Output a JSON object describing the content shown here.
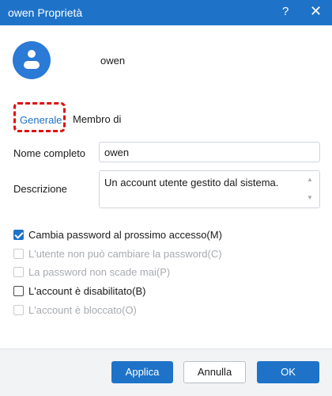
{
  "window": {
    "title": "owen Proprietà",
    "help_glyph": "?",
    "close_glyph": "✕",
    "accent_color": "#1e73c8"
  },
  "user": {
    "name": "owen"
  },
  "tabs": [
    {
      "label": "Generale",
      "active": true
    },
    {
      "label": "Membro di",
      "active": false
    }
  ],
  "form": {
    "full_name_label": "Nome completo",
    "full_name_value": "owen",
    "description_label": "Descrizione",
    "description_value": "Un account utente gestito dal sistema."
  },
  "options": [
    {
      "label": "Cambia password al prossimo accesso(M)",
      "checked": true,
      "enabled": true
    },
    {
      "label": "L'utente non può cambiare la password(C)",
      "checked": false,
      "enabled": false
    },
    {
      "label": "La password non scade mai(P)",
      "checked": false,
      "enabled": false
    },
    {
      "label": "L'account è disabilitato(B)",
      "checked": false,
      "enabled": true
    },
    {
      "label": "L'account è bloccato(O)",
      "checked": false,
      "enabled": false
    }
  ],
  "buttons": {
    "apply": "Applica",
    "cancel": "Annulla",
    "ok": "OK"
  }
}
